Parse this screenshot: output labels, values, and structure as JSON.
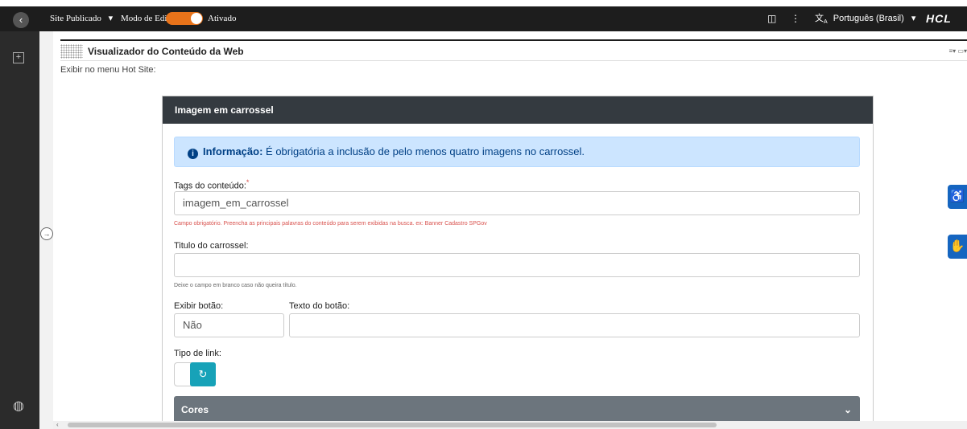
{
  "topbar": {
    "back_icon": "chevron-left-icon",
    "site_label": "Site Publicado",
    "dropdown_caret": "▾",
    "edit_mode_label": "Modo de Edição:",
    "edit_mode_state": "Ativado",
    "toggle_color": "#e8731a",
    "panel_icon": "◫",
    "more_icon": "⋮",
    "language_label": "Português (Brasil)",
    "language_icon": "translate-icon",
    "brand": "HCL"
  },
  "portlet": {
    "title": "Visualizador do Conteúdo da Web",
    "hotsite_label": "Exibir no menu Hot Site:"
  },
  "form": {
    "header": "Imagem em carrossel",
    "alert_strong": "Informação:",
    "alert_text": "É obrigatória a inclusão de pelo menos quatro imagens no carrossel.",
    "tags_label": "Tags do conteúdo:",
    "required_mark": "*",
    "tags_value": "imagem_em_carrossel",
    "tags_error": "Campo obrigatório. Preencha as principais palavras do conteúdo para serem exibidas na busca. ex: Banner Cadastro SPGov",
    "title_label": "Titulo do carrossel:",
    "title_value": "",
    "title_help": "Deixe o campo em branco caso não queira título.",
    "show_button_label": "Exibir botão:",
    "show_button_value": "Não",
    "button_text_label": "Texto do botão:",
    "button_text_value": "",
    "link_type_label": "Tipo de link:",
    "cores_label": "Cores"
  },
  "colors": {
    "header_bg": "#343a40",
    "alert_bg": "#cce5ff",
    "cores_bg": "#6c757d",
    "switch_btn": "#17a2b8",
    "accessibility_blue": "#1565c0"
  }
}
